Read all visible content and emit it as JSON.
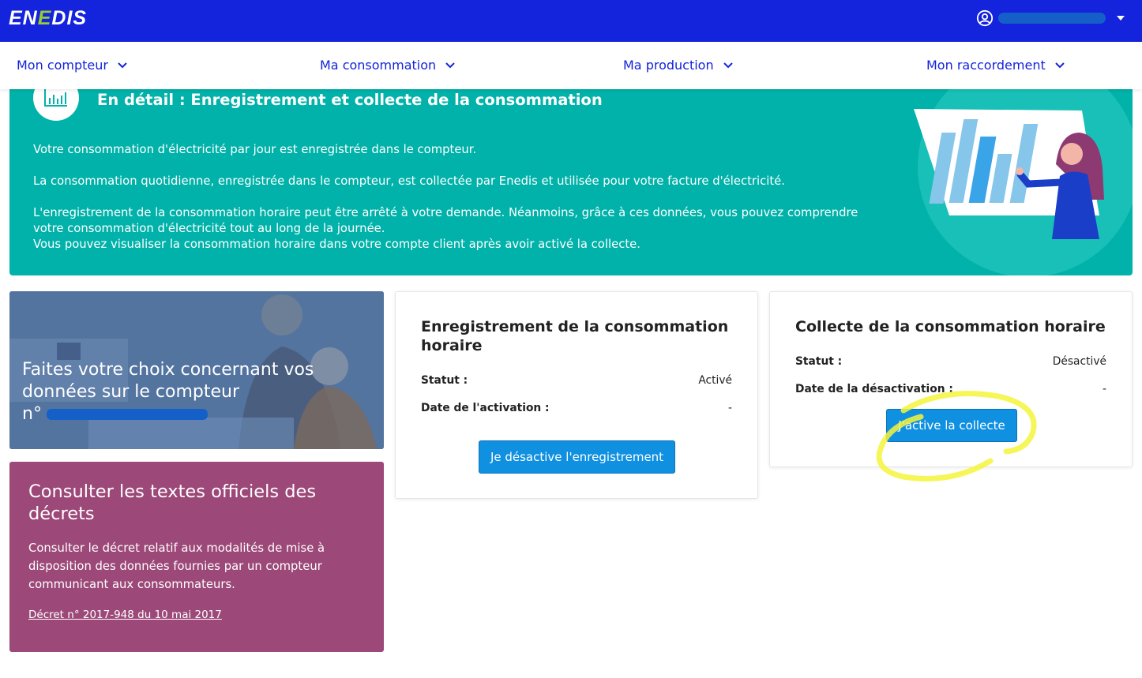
{
  "header": {
    "logo_text": "ENEDIS",
    "brand_color": "#1423dc",
    "logo_accent": "#96cd32"
  },
  "nav": {
    "items": [
      {
        "label": "Mon compteur"
      },
      {
        "label": "Ma consommation"
      },
      {
        "label": "Ma production"
      },
      {
        "label": "Mon raccordement"
      }
    ]
  },
  "hero": {
    "title": "En détail : Enregistrement et collecte de la consommation",
    "paragraphs": [
      "Votre consommation d'électricité par jour est enregistrée dans le compteur.",
      "La consommation quotidienne, enregistrée dans le compteur, est collectée par Enedis et utilisée pour votre facture d'électricité.",
      "L'enregistrement de la consommation horaire peut être arrêté à votre demande. Néanmoins, grâce à ces données, vous pouvez comprendre votre consommation d'électricité tout au long de la journée.",
      "Vous pouvez visualiser la consommation horaire dans votre compte client après avoir activé la collecte."
    ],
    "bg_color": "#00b2a9"
  },
  "photo_card": {
    "title": "Faites votre choix concernant vos données sur le compteur",
    "meter_prefix": "n°"
  },
  "decree_card": {
    "title": "Consulter les textes officiels des décrets",
    "text": "Consulter le décret relatif aux modalités de mise à disposition des données fournies par un compteur communicant aux consommateurs.",
    "link": "Décret n° 2017-948 du 10 mai 2017",
    "bg_color": "#9c4878"
  },
  "recording_card": {
    "title": "Enregistrement de la consommation horaire",
    "status_label": "Statut :",
    "status_value": "Activé",
    "date_label": "Date de l'activation :",
    "date_value": "-",
    "button": "Je désactive l'enregistrement"
  },
  "collect_card": {
    "title": "Collecte de la consommation horaire",
    "status_label": "Statut :",
    "status_value": "Désactivé",
    "date_label": "Date de la désactivation :",
    "date_value": "-",
    "button": "J'active la collecte"
  },
  "button_color": "#1090e0",
  "highlight_color": "#f4f43c"
}
